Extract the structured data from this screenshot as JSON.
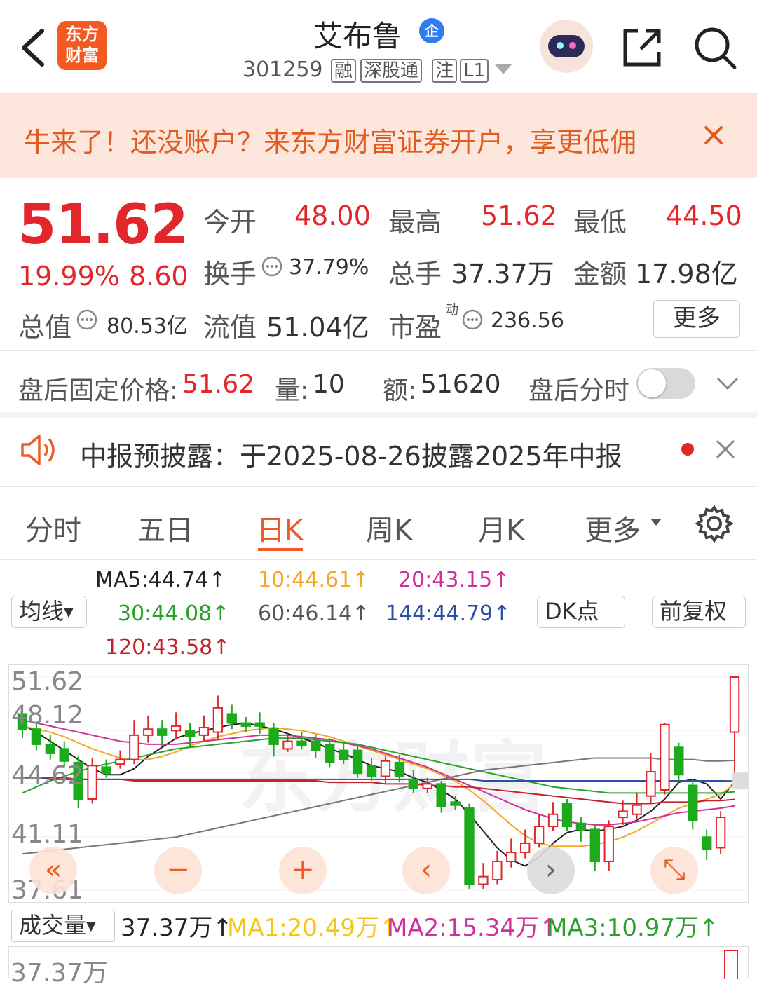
{
  "header": {
    "logo_text_line1": "东方",
    "logo_text_line2": "财富",
    "title": "艾布鲁",
    "title_badge": "企",
    "code": "301259",
    "tags": [
      "融",
      "深股通",
      "注",
      "L1"
    ]
  },
  "banner": {
    "text": "牛来了！还没账户？来东方财富证券开户，享更低佣",
    "close": "×"
  },
  "quote": {
    "price": "51.62",
    "change_pct": "19.99%",
    "change_amt": "8.60",
    "open_label": "今开",
    "open": "48.00",
    "high_label": "最高",
    "high": "51.62",
    "low_label": "最低",
    "low": "44.50",
    "turnover_label": "换手",
    "turnover": "37.79%",
    "volume_label": "总手",
    "volume": "37.37万",
    "amount_label": "金额",
    "amount": "17.98亿",
    "mktcap_label": "总值",
    "mktcap": "80.53亿",
    "float_label": "流值",
    "float": "51.04亿",
    "pe_label": "市盈",
    "pe_sup": "动",
    "pe": "236.56",
    "more": "更多"
  },
  "after_hours": {
    "price_label": "盘后固定价格:",
    "price": "51.62",
    "vol_label": "量:",
    "vol": "10",
    "amt_label": "额:",
    "amt": "51620",
    "intraday_label": "盘后分时"
  },
  "notice": {
    "text": "中报预披露：于2025-08-26披露2025年中报"
  },
  "tabs": {
    "t1": "分时",
    "t2": "五日",
    "t3": "日K",
    "t4": "周K",
    "t5": "月K",
    "t6": "更多"
  },
  "ma_legend": {
    "ma5": "MA5:44.74↑",
    "ma10": "10:44.61↑",
    "ma20": "20:43.15↑",
    "ma30": "30:44.08↑",
    "ma60": "60:46.14↑",
    "ma144": "144:44.79↑",
    "ma120": "120:43.58↑",
    "avg_btn": "均线",
    "dk_btn": "DK点",
    "adj_btn": "前复权"
  },
  "chart_data": {
    "type": "candlestick",
    "y_labels": [
      "51.62",
      "48.12",
      "44.62",
      "41.11",
      "37.61"
    ],
    "ylim": [
      37.61,
      51.62
    ],
    "watermark": "东方财富",
    "candles": [
      {
        "o": 49.2,
        "c": 48.2,
        "h": 49.8,
        "l": 47.6
      },
      {
        "o": 48.2,
        "c": 47.2,
        "h": 48.6,
        "l": 46.8
      },
      {
        "o": 47.2,
        "c": 46.6,
        "h": 47.8,
        "l": 46.2
      },
      {
        "o": 46.9,
        "c": 46.1,
        "h": 47.4,
        "l": 45.7
      },
      {
        "o": 46.0,
        "c": 43.6,
        "h": 46.4,
        "l": 43.0
      },
      {
        "o": 43.6,
        "c": 45.8,
        "h": 46.3,
        "l": 43.3
      },
      {
        "o": 45.7,
        "c": 45.3,
        "h": 46.2,
        "l": 45.0
      },
      {
        "o": 45.9,
        "c": 46.2,
        "h": 46.8,
        "l": 45.6
      },
      {
        "o": 46.2,
        "c": 47.8,
        "h": 48.8,
        "l": 45.9
      },
      {
        "o": 47.8,
        "c": 48.2,
        "h": 49.1,
        "l": 47.3
      },
      {
        "o": 48.2,
        "c": 47.8,
        "h": 48.8,
        "l": 47.1
      },
      {
        "o": 48.1,
        "c": 48.4,
        "h": 49.3,
        "l": 47.5
      },
      {
        "o": 48.1,
        "c": 47.7,
        "h": 48.6,
        "l": 47.0
      },
      {
        "o": 47.8,
        "c": 48.3,
        "h": 49.1,
        "l": 47.4
      },
      {
        "o": 48.0,
        "c": 49.6,
        "h": 50.4,
        "l": 47.5
      },
      {
        "o": 49.2,
        "c": 48.6,
        "h": 49.8,
        "l": 48.2
      },
      {
        "o": 48.6,
        "c": 48.4,
        "h": 49.0,
        "l": 48.0
      },
      {
        "o": 48.6,
        "c": 48.4,
        "h": 49.3,
        "l": 47.9
      },
      {
        "o": 48.2,
        "c": 47.2,
        "h": 48.6,
        "l": 46.4
      },
      {
        "o": 46.9,
        "c": 47.4,
        "h": 47.8,
        "l": 46.7
      },
      {
        "o": 47.4,
        "c": 47.1,
        "h": 48.0,
        "l": 46.9
      },
      {
        "o": 47.4,
        "c": 46.8,
        "h": 47.8,
        "l": 46.3
      },
      {
        "o": 47.2,
        "c": 46.0,
        "h": 47.6,
        "l": 45.7
      },
      {
        "o": 46.8,
        "c": 46.2,
        "h": 47.3,
        "l": 45.9
      },
      {
        "o": 46.8,
        "c": 45.3,
        "h": 47.2,
        "l": 45.0
      },
      {
        "o": 45.8,
        "c": 45.1,
        "h": 46.3,
        "l": 44.8
      },
      {
        "o": 45.1,
        "c": 46.1,
        "h": 46.4,
        "l": 44.6
      },
      {
        "o": 46.0,
        "c": 45.1,
        "h": 46.5,
        "l": 44.7
      },
      {
        "o": 44.9,
        "c": 44.3,
        "h": 45.5,
        "l": 44.0
      },
      {
        "o": 44.3,
        "c": 44.6,
        "h": 45.0,
        "l": 44.0
      },
      {
        "o": 44.6,
        "c": 43.1,
        "h": 44.8,
        "l": 42.7
      },
      {
        "o": 43.4,
        "c": 43.2,
        "h": 43.8,
        "l": 42.9
      },
      {
        "o": 43.0,
        "c": 38.0,
        "h": 43.3,
        "l": 37.7
      },
      {
        "o": 38.0,
        "c": 38.5,
        "h": 39.4,
        "l": 37.7
      },
      {
        "o": 38.3,
        "c": 39.5,
        "h": 40.2,
        "l": 38.0
      },
      {
        "o": 39.5,
        "c": 40.1,
        "h": 41.0,
        "l": 39.1
      },
      {
        "o": 40.1,
        "c": 40.7,
        "h": 41.6,
        "l": 39.7
      },
      {
        "o": 40.7,
        "c": 41.8,
        "h": 42.6,
        "l": 40.4
      },
      {
        "o": 41.8,
        "c": 42.6,
        "h": 43.4,
        "l": 41.5
      },
      {
        "o": 43.3,
        "c": 41.8,
        "h": 43.6,
        "l": 41.5
      },
      {
        "o": 42.0,
        "c": 41.6,
        "h": 42.4,
        "l": 40.8
      },
      {
        "o": 41.6,
        "c": 39.5,
        "h": 41.9,
        "l": 38.9
      },
      {
        "o": 39.5,
        "c": 41.8,
        "h": 42.2,
        "l": 38.9
      },
      {
        "o": 42.4,
        "c": 42.8,
        "h": 43.5,
        "l": 41.9
      },
      {
        "o": 42.6,
        "c": 43.2,
        "h": 44.0,
        "l": 42.2
      },
      {
        "o": 43.8,
        "c": 45.4,
        "h": 46.6,
        "l": 43.3
      },
      {
        "o": 44.2,
        "c": 48.5,
        "h": 48.6,
        "l": 43.9
      },
      {
        "o": 47.0,
        "c": 45.2,
        "h": 47.3,
        "l": 44.8
      },
      {
        "o": 44.5,
        "c": 42.2,
        "h": 44.9,
        "l": 41.6
      },
      {
        "o": 41.1,
        "c": 40.3,
        "h": 41.6,
        "l": 39.6
      },
      {
        "o": 40.4,
        "c": 42.4,
        "h": 42.8,
        "l": 40.0
      },
      {
        "o": 48.0,
        "c": 51.62,
        "h": 51.62,
        "l": 44.5
      }
    ],
    "ma_lines": {
      "ma5": [
        48.5,
        48.0,
        47.4,
        46.8,
        46.2,
        45.6,
        45.2,
        45.2,
        45.6,
        46.4,
        47.0,
        47.6,
        47.9,
        48.1,
        48.3,
        48.5,
        48.6,
        48.4,
        48.2,
        47.9,
        47.6,
        47.3,
        46.9,
        46.6,
        46.2,
        45.8,
        45.6,
        45.4,
        45.0,
        44.7,
        44.2,
        43.6,
        42.6,
        41.5,
        40.4,
        39.6,
        39.2,
        39.8,
        40.7,
        41.4,
        41.6,
        41.5,
        41.6,
        41.8,
        42.2,
        42.8,
        43.6,
        44.7,
        44.9,
        44.6,
        43.6,
        44.74
      ],
      "ma10": [
        48.4,
        48.2,
        48.0,
        47.7,
        47.3,
        46.9,
        46.6,
        46.3,
        46.2,
        46.2,
        46.4,
        46.7,
        47.1,
        47.4,
        47.7,
        47.9,
        48.1,
        48.2,
        48.3,
        48.2,
        48.1,
        47.9,
        47.7,
        47.4,
        47.1,
        46.8,
        46.5,
        46.2,
        45.9,
        45.6,
        45.2,
        44.8,
        44.2,
        43.5,
        42.7,
        41.9,
        41.2,
        40.7,
        40.5,
        40.5,
        40.5,
        40.6,
        40.8,
        41.1,
        41.5,
        42.0,
        42.5,
        43.0,
        43.3,
        43.6,
        43.9,
        44.61
      ],
      "ma20": [
        48.8,
        48.6,
        48.4,
        48.2,
        48.0,
        47.8,
        47.6,
        47.4,
        47.3,
        47.2,
        47.2,
        47.2,
        47.3,
        47.4,
        47.5,
        47.6,
        47.7,
        47.8,
        47.8,
        47.8,
        47.7,
        47.6,
        47.5,
        47.3,
        47.1,
        46.9,
        46.6,
        46.3,
        46.0,
        45.7,
        45.3,
        44.9,
        44.5,
        44.1,
        43.7,
        43.3,
        42.9,
        42.6,
        42.3,
        42.1,
        42.0,
        41.9,
        41.9,
        42.0,
        42.1,
        42.3,
        42.5,
        42.7,
        42.8,
        42.9,
        43.0,
        43.15
      ],
      "ma30": [
        44.0,
        44.4,
        44.8,
        45.1,
        45.4,
        45.7,
        45.9,
        46.1,
        46.3,
        46.5,
        46.7,
        46.9,
        47.0,
        47.1,
        47.2,
        47.3,
        47.4,
        47.5,
        47.6,
        47.6,
        47.6,
        47.5,
        47.4,
        47.3,
        47.2,
        47.0,
        46.8,
        46.6,
        46.4,
        46.2,
        46.0,
        45.8,
        45.6,
        45.4,
        45.2,
        45.0,
        44.8,
        44.6,
        44.4,
        44.3,
        44.2,
        44.1,
        44.0,
        44.0,
        44.0,
        44.0,
        44.0,
        44.0,
        44.0,
        44.0,
        44.0,
        44.08
      ],
      "ma60": [
        40.0,
        40.1,
        40.2,
        40.3,
        40.4,
        40.5,
        40.6,
        40.7,
        40.8,
        40.9,
        41.0,
        41.1,
        41.3,
        41.5,
        41.7,
        41.9,
        42.1,
        42.3,
        42.5,
        42.7,
        42.9,
        43.1,
        43.3,
        43.5,
        43.7,
        43.9,
        44.1,
        44.3,
        44.5,
        44.7,
        44.9,
        45.1,
        45.3,
        45.5,
        45.6,
        45.7,
        45.8,
        45.9,
        46.0,
        46.1,
        46.2,
        46.3,
        46.3,
        46.3,
        46.3,
        46.3,
        46.2,
        46.2,
        46.2,
        46.1,
        46.1,
        46.14
      ],
      "ma120": [
        45.0,
        45.0,
        45.0,
        45.0,
        44.9,
        44.9,
        44.9,
        44.9,
        44.8,
        44.8,
        44.8,
        44.8,
        44.8,
        44.8,
        44.8,
        44.8,
        44.8,
        44.8,
        44.8,
        44.8,
        44.8,
        44.8,
        44.7,
        44.7,
        44.7,
        44.7,
        44.6,
        44.6,
        44.6,
        44.5,
        44.5,
        44.4,
        44.4,
        44.3,
        44.2,
        44.1,
        44.0,
        43.9,
        43.8,
        43.7,
        43.6,
        43.5,
        43.4,
        43.3,
        43.3,
        43.3,
        43.4,
        43.4,
        43.4,
        43.5,
        43.5,
        43.58
      ],
      "ma144": [
        45.0,
        45.0,
        44.9,
        44.9,
        44.9,
        44.9,
        44.9,
        44.9,
        44.9,
        44.9,
        44.9,
        44.9,
        44.9,
        44.9,
        44.9,
        44.9,
        44.9,
        44.9,
        44.9,
        44.9,
        44.9,
        44.9,
        44.9,
        44.9,
        44.9,
        44.9,
        44.9,
        44.9,
        44.9,
        44.9,
        44.9,
        44.9,
        44.9,
        44.8,
        44.8,
        44.8,
        44.8,
        44.8,
        44.8,
        44.8,
        44.8,
        44.8,
        44.8,
        44.8,
        44.8,
        44.8,
        44.8,
        44.8,
        44.8,
        44.8,
        44.8,
        44.79
      ]
    },
    "ma_colors": {
      "ma5": "#222222",
      "ma10": "#f5a623",
      "ma20": "#d0309a",
      "ma30": "#2ca02c",
      "ma60": "#777777",
      "ma120": "#c0222a",
      "ma144": "#2b4fa8"
    }
  },
  "volume": {
    "label": "成交量",
    "value": "37.37万↑",
    "ma1": "MA1:20.49万↑",
    "ma2": "MA2:15.34万↑",
    "ma3": "MA3:10.97万↑",
    "axis_top": "37.37万"
  },
  "colors": {
    "up": "#e3262c",
    "down": "#1bab1b",
    "accent": "#f05a28"
  }
}
